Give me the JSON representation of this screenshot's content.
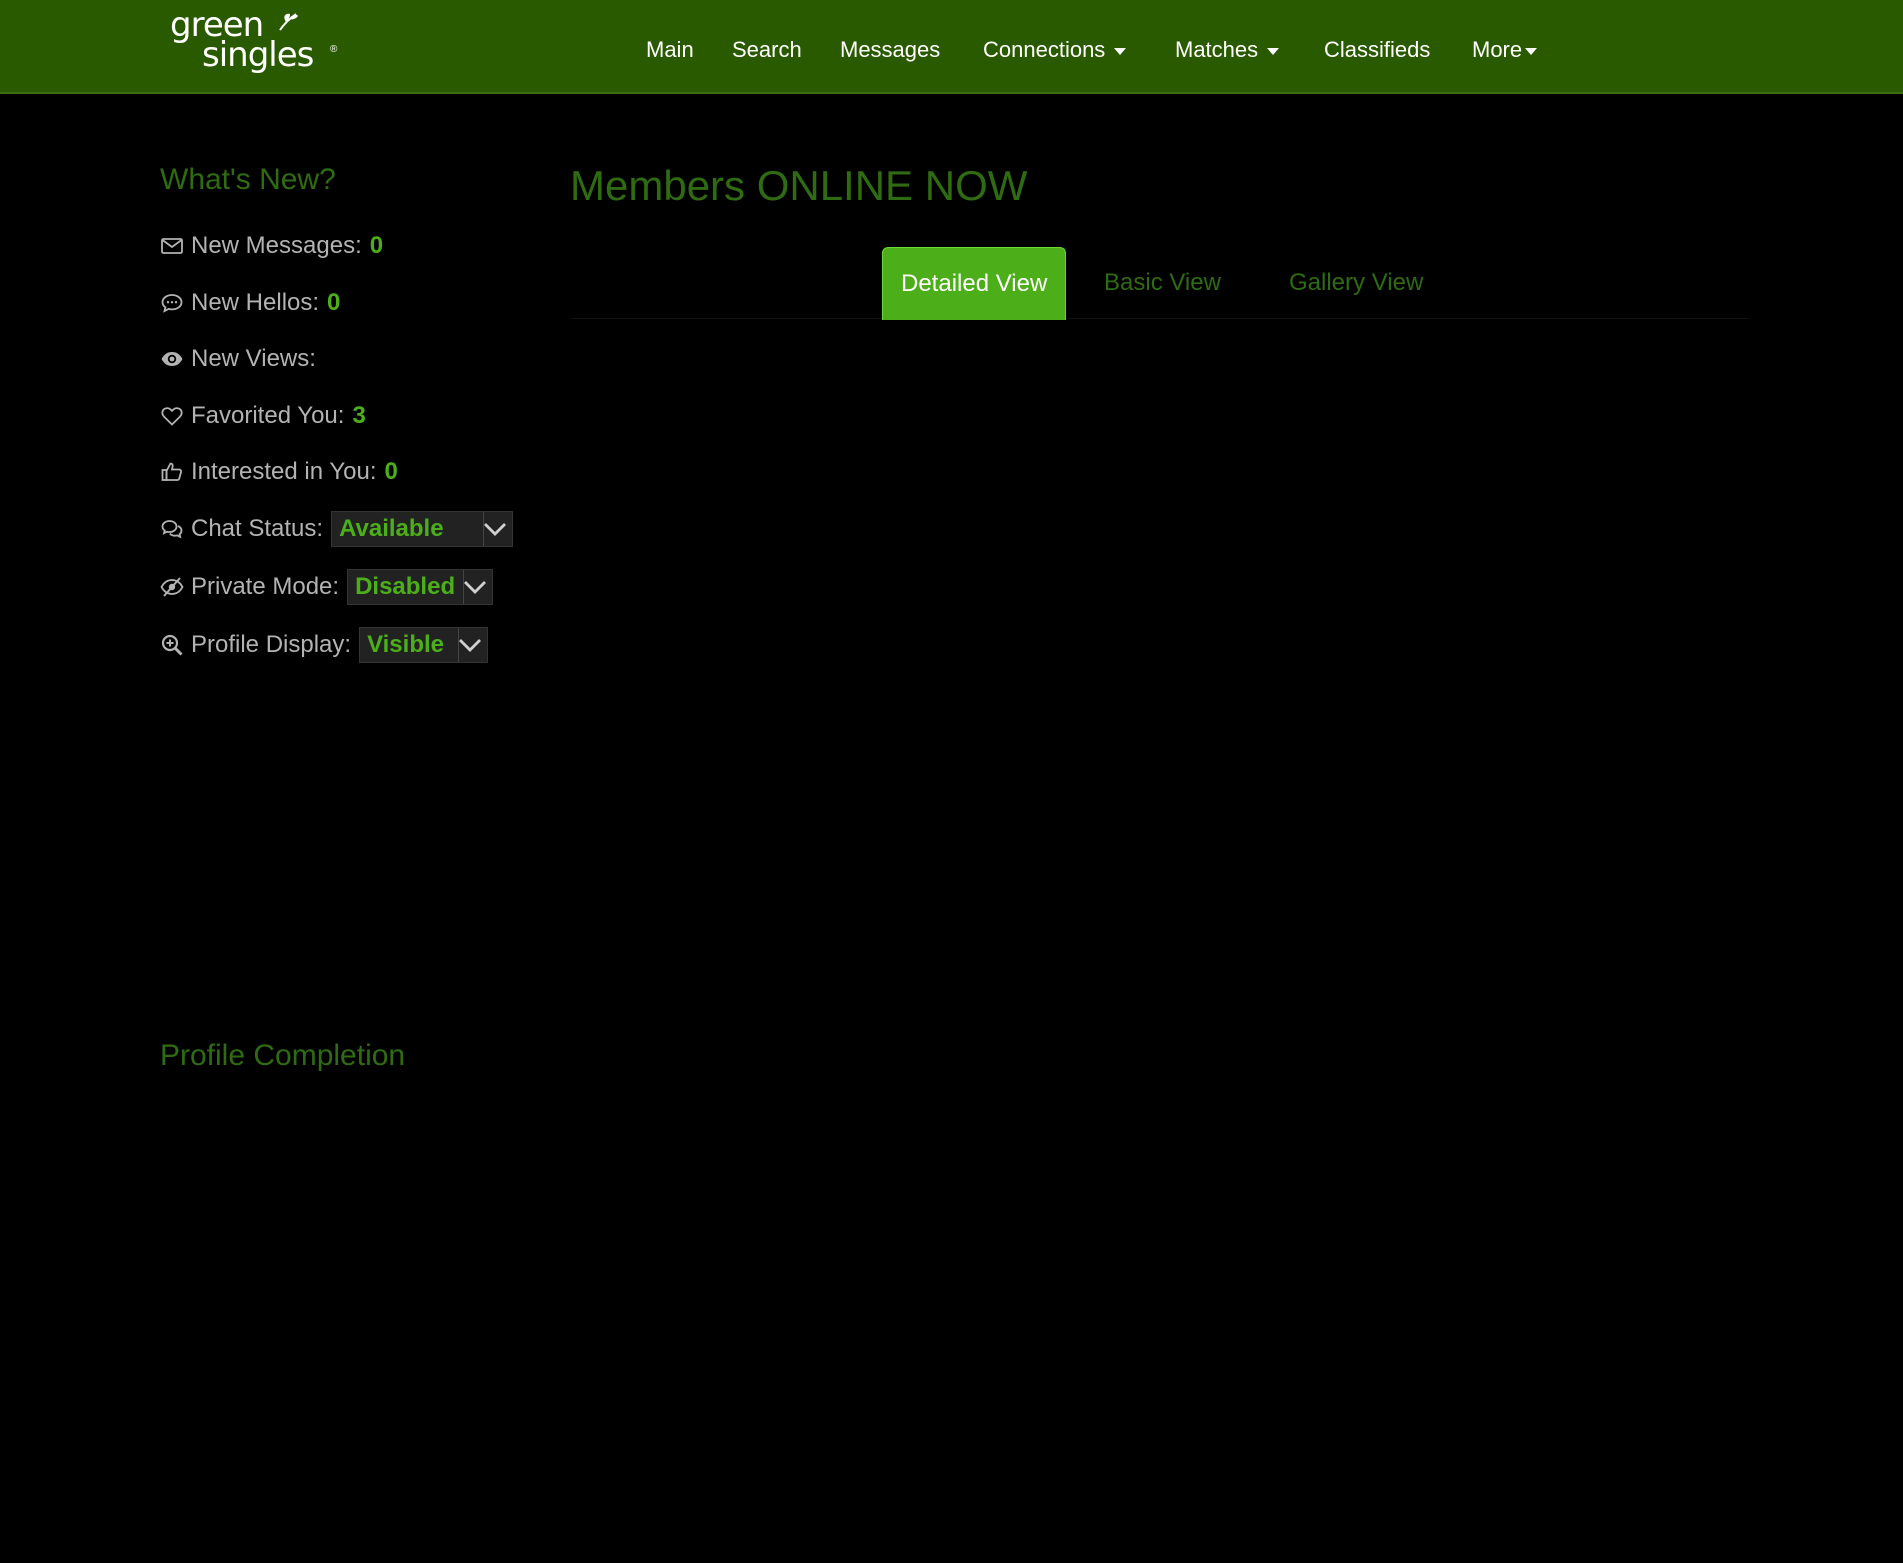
{
  "logo": {
    "line1": "green",
    "line2": "singles",
    "reg": "®"
  },
  "nav": {
    "items": [
      {
        "label": "Main"
      },
      {
        "label": "Search"
      },
      {
        "label": "Messages"
      },
      {
        "label": "Connections"
      },
      {
        "label": "Matches"
      },
      {
        "label": "Classifieds"
      },
      {
        "label": "More"
      }
    ]
  },
  "sidebar": {
    "whats_new_title": "What's New?",
    "new_messages": {
      "label": "New Messages:",
      "value": "0",
      "icon": "envelope-icon"
    },
    "new_hellos": {
      "label": "New Hellos:",
      "value": "0",
      "icon": "speech-bubble-icon"
    },
    "new_views": {
      "label": "New Views:",
      "value": "",
      "icon": "eye-icon"
    },
    "favorited_you": {
      "label": "Favorited You:",
      "value": "3",
      "icon": "heart-icon"
    },
    "interested_in_you": {
      "label": "Interested in You:",
      "value": "0",
      "icon": "thumbs-up-icon"
    },
    "chat_status": {
      "label": "Chat Status:",
      "value": "Available",
      "icon": "chat-bubbles-icon"
    },
    "private_mode": {
      "label": "Private Mode:",
      "value": "Disabled",
      "icon": "eye-slash-icon"
    },
    "profile_display": {
      "label": "Profile Display:",
      "value": "Visible",
      "icon": "search-plus-icon"
    },
    "profile_completion_title": "Profile Completion"
  },
  "main": {
    "title": "Members ONLINE NOW",
    "tabs": [
      {
        "label": "Detailed View",
        "active": true
      },
      {
        "label": "Basic View",
        "active": false
      },
      {
        "label": "Gallery View",
        "active": false
      }
    ]
  },
  "colors": {
    "header_bg": "#2a5a00",
    "accent_green": "#4caf1a",
    "title_green": "#2f6b12",
    "page_bg": "#000000"
  }
}
